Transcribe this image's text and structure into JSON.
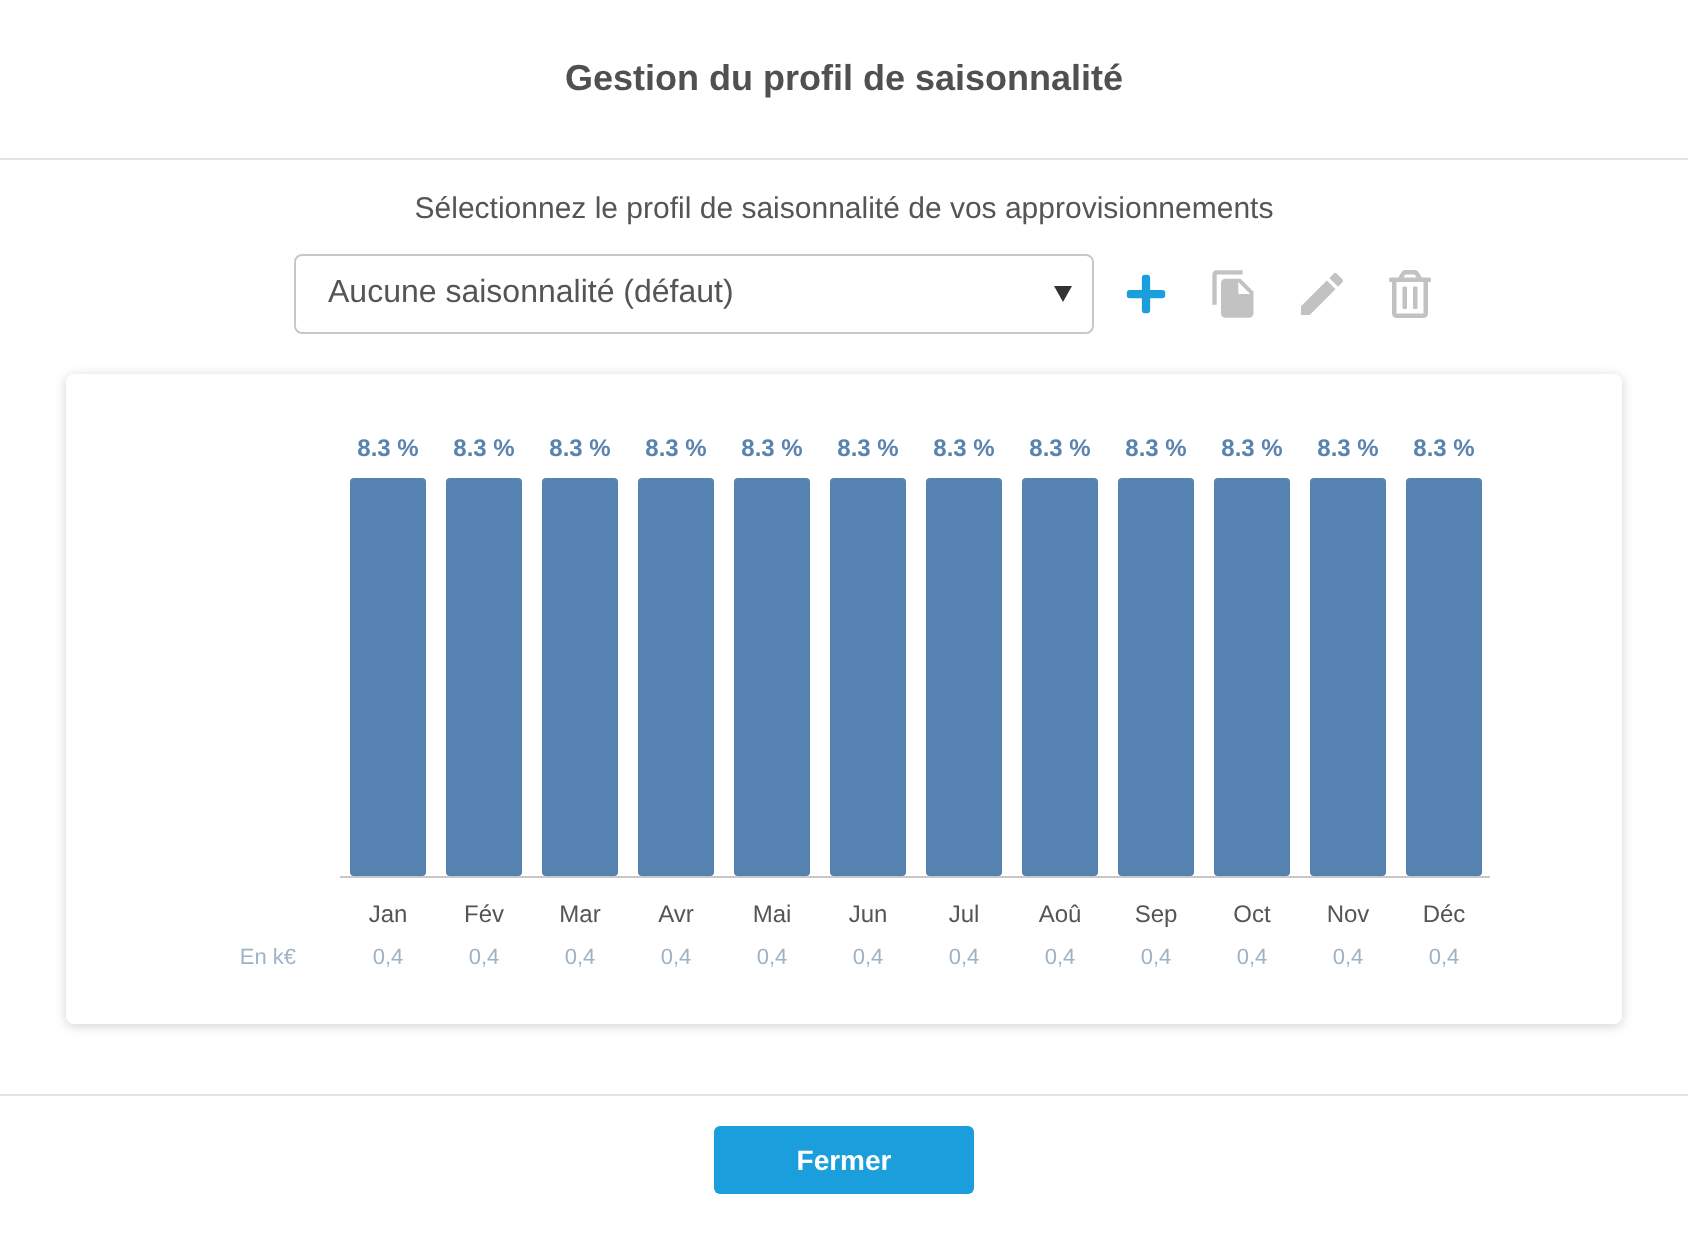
{
  "dialog": {
    "title": "Gestion du profil de saisonnalité"
  },
  "instruction": "Sélectionnez le profil de saisonnalité de vos approvisionnements",
  "profile_select": {
    "value": "Aucune saisonnalité (défaut)"
  },
  "toolbar": [
    {
      "kind": "add",
      "disabled": false
    },
    {
      "kind": "copy",
      "disabled": true
    },
    {
      "kind": "edit",
      "disabled": true
    },
    {
      "kind": "delete",
      "disabled": true
    }
  ],
  "chart": {
    "chart_data": {
      "type": "bar",
      "categories": [
        "Jan",
        "Fév",
        "Mar",
        "Avr",
        "Mai",
        "Jun",
        "Jul",
        "Aoû",
        "Sep",
        "Oct",
        "Nov",
        "Déc"
      ],
      "values": [
        8.3,
        8.3,
        8.3,
        8.3,
        8.3,
        8.3,
        8.3,
        8.3,
        8.3,
        8.3,
        8.3,
        8.3
      ],
      "value_labels": [
        "8.3 %",
        "8.3 %",
        "8.3 %",
        "8.3 %",
        "8.3 %",
        "8.3 %",
        "8.3 %",
        "8.3 %",
        "8.3 %",
        "8.3 %",
        "8.3 %",
        "8.3 %"
      ]
    }
  },
  "amounts": {
    "label": "En k€",
    "values": [
      "0,4",
      "0,4",
      "0,4",
      "0,4",
      "0,4",
      "0,4",
      "0,4",
      "0,4",
      "0,4",
      "0,4",
      "0,4",
      "0,4"
    ]
  },
  "buttons": [
    {
      "label": "Fermer"
    }
  ]
}
